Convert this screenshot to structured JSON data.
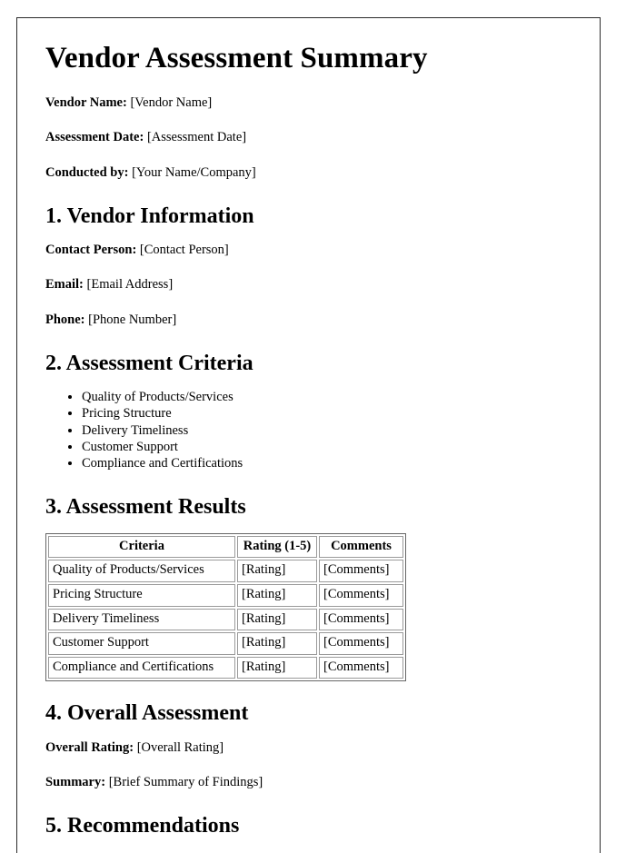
{
  "document": {
    "title": "Vendor Assessment Summary",
    "header_fields": [
      {
        "label": "Vendor Name:",
        "value": "[Vendor Name]"
      },
      {
        "label": "Assessment Date:",
        "value": "[Assessment Date]"
      },
      {
        "label": "Conducted by:",
        "value": "[Your Name/Company]"
      }
    ],
    "sections": {
      "vendor_information": {
        "heading": "1. Vendor Information",
        "fields": [
          {
            "label": "Contact Person:",
            "value": "[Contact Person]"
          },
          {
            "label": "Email:",
            "value": "[Email Address]"
          },
          {
            "label": "Phone:",
            "value": "[Phone Number]"
          }
        ]
      },
      "assessment_criteria": {
        "heading": "2. Assessment Criteria",
        "items": [
          "Quality of Products/Services",
          "Pricing Structure",
          "Delivery Timeliness",
          "Customer Support",
          "Compliance and Certifications"
        ]
      },
      "assessment_results": {
        "heading": "3. Assessment Results",
        "table": {
          "columns": [
            "Criteria",
            "Rating (1-5)",
            "Comments"
          ],
          "rows": [
            [
              "Quality of Products/Services",
              "[Rating]",
              "[Comments]"
            ],
            [
              "Pricing Structure",
              "[Rating]",
              "[Comments]"
            ],
            [
              "Delivery Timeliness",
              "[Rating]",
              "[Comments]"
            ],
            [
              "Customer Support",
              "[Rating]",
              "[Comments]"
            ],
            [
              "Compliance and Certifications",
              "[Rating]",
              "[Comments]"
            ]
          ]
        }
      },
      "overall_assessment": {
        "heading": "4. Overall Assessment",
        "fields": [
          {
            "label": "Overall Rating:",
            "value": "[Overall Rating]"
          },
          {
            "label": "Summary:",
            "value": "[Brief Summary of Findings]"
          }
        ]
      },
      "recommendations": {
        "heading": "5. Recommendations"
      }
    }
  }
}
